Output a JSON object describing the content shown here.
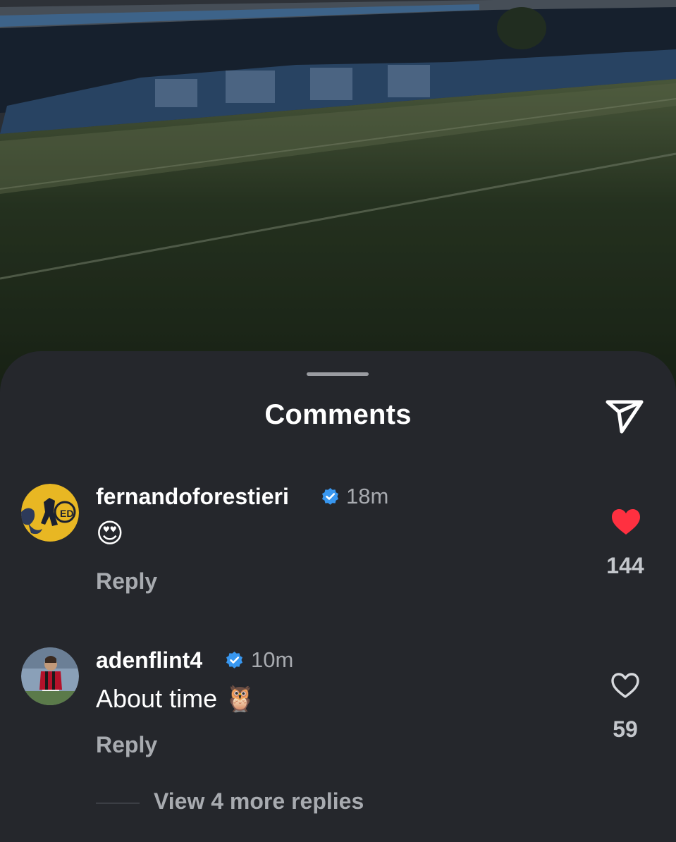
{
  "sheet": {
    "title": "Comments"
  },
  "icons": {
    "send": "send-icon",
    "verified": "verified-badge-icon",
    "heart_filled": "heart-filled-icon",
    "heart_outline": "heart-outline-icon"
  },
  "colors": {
    "sheet_bg": "#25272c",
    "verified_blue": "#3897f0",
    "like_red": "#ff3040",
    "muted_text": "#a8abb0"
  },
  "comments": [
    {
      "username": "fernandoforestieri",
      "verified": true,
      "time": "18m",
      "text": "😍",
      "reply_label": "Reply",
      "liked": true,
      "likes": "144"
    },
    {
      "username": "adenflint4",
      "verified": true,
      "time": "10m",
      "text": "About time 🦉",
      "reply_label": "Reply",
      "liked": false,
      "likes": "59",
      "view_replies": "View 4 more replies"
    }
  ]
}
